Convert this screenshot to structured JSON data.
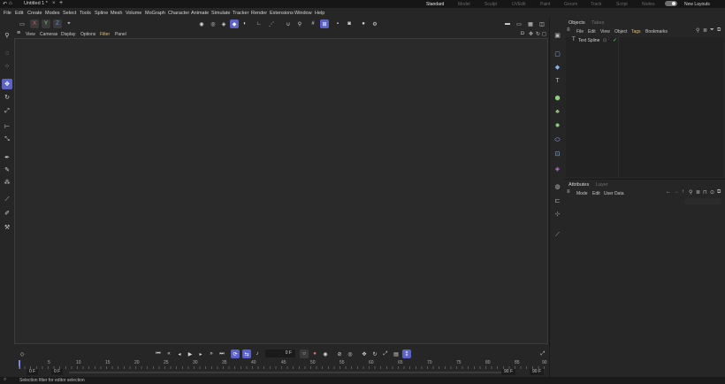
{
  "document_tab": {
    "title": "Untitled 1 *"
  },
  "layouts": {
    "tabs": [
      "Standard",
      "Model",
      "Sculpt",
      "UVEdit",
      "Paint",
      "Groom",
      "Track",
      "Script",
      "Nodes"
    ],
    "active": "Standard",
    "new_layouts": "New Layouts"
  },
  "menu": [
    "File",
    "Edit",
    "Create",
    "Modes",
    "Select",
    "Tools",
    "Spline",
    "Mesh",
    "Volume",
    "MoGraph",
    "Character",
    "Animate",
    "Simulate",
    "Tracker",
    "Render",
    "Extensions",
    "Window",
    "Help"
  ],
  "toolbar": {
    "axis_x": "X",
    "axis_y": "Y",
    "axis_z": "Z"
  },
  "viewport": {
    "menu": [
      "View",
      "Cameras",
      "Display",
      "Options",
      "Filter",
      "Panel"
    ]
  },
  "objects_panel": {
    "tabs": [
      "Objects",
      "Takes"
    ],
    "menu": [
      "File",
      "Edit",
      "View",
      "Object",
      "Tags",
      "Bookmarks"
    ],
    "objects": [
      {
        "name": "Text Spline"
      }
    ]
  },
  "attributes_panel": {
    "tabs": [
      "Attributes",
      "Layer"
    ],
    "menu": [
      "Mode",
      "Edit",
      "User Data"
    ]
  },
  "timeline": {
    "current_frame": "0 F",
    "ruler_ticks": [
      "0",
      "5",
      "10",
      "15",
      "20",
      "25",
      "30",
      "35",
      "40",
      "45",
      "50",
      "55",
      "60",
      "65",
      "70",
      "75",
      "80",
      "85",
      "90"
    ],
    "range_start": "0 F",
    "preview_start": "0 F",
    "preview_end": "90 F",
    "range_end": "90 F"
  },
  "status": {
    "text": "Selection filter for editor selection"
  },
  "colors": {
    "accent": "#5c63c8",
    "background": "#262626",
    "viewport": "#2a2a2a",
    "record": "#d94545"
  }
}
